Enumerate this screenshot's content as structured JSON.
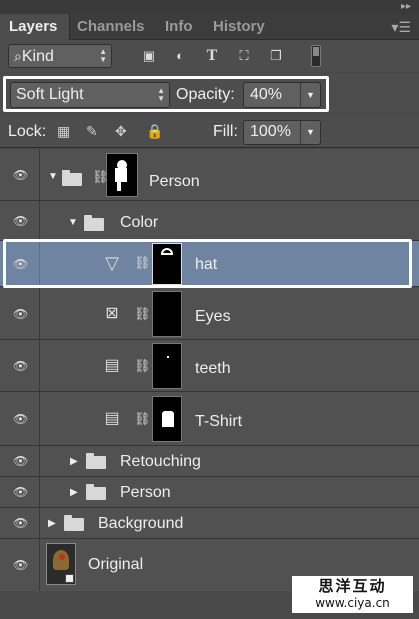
{
  "tabs": [
    "Layers",
    "Channels",
    "Info",
    "History"
  ],
  "filter": {
    "kind_label": "Kind"
  },
  "blend": {
    "mode": "Soft Light",
    "opacity_label": "Opacity:",
    "opacity_value": "40%"
  },
  "lock": {
    "label": "Lock:",
    "fill_label": "Fill:",
    "fill_value": "100%"
  },
  "layers": [
    {
      "name": "Person"
    },
    {
      "name": "Color"
    },
    {
      "name": "hat"
    },
    {
      "name": "Eyes"
    },
    {
      "name": "teeth"
    },
    {
      "name": "T-Shirt"
    },
    {
      "name": "Retouching"
    },
    {
      "name": "Person"
    },
    {
      "name": "Background"
    },
    {
      "name": "Original"
    }
  ],
  "watermark": {
    "line1": "思洋互动",
    "line2": "www.ciya.cn"
  }
}
